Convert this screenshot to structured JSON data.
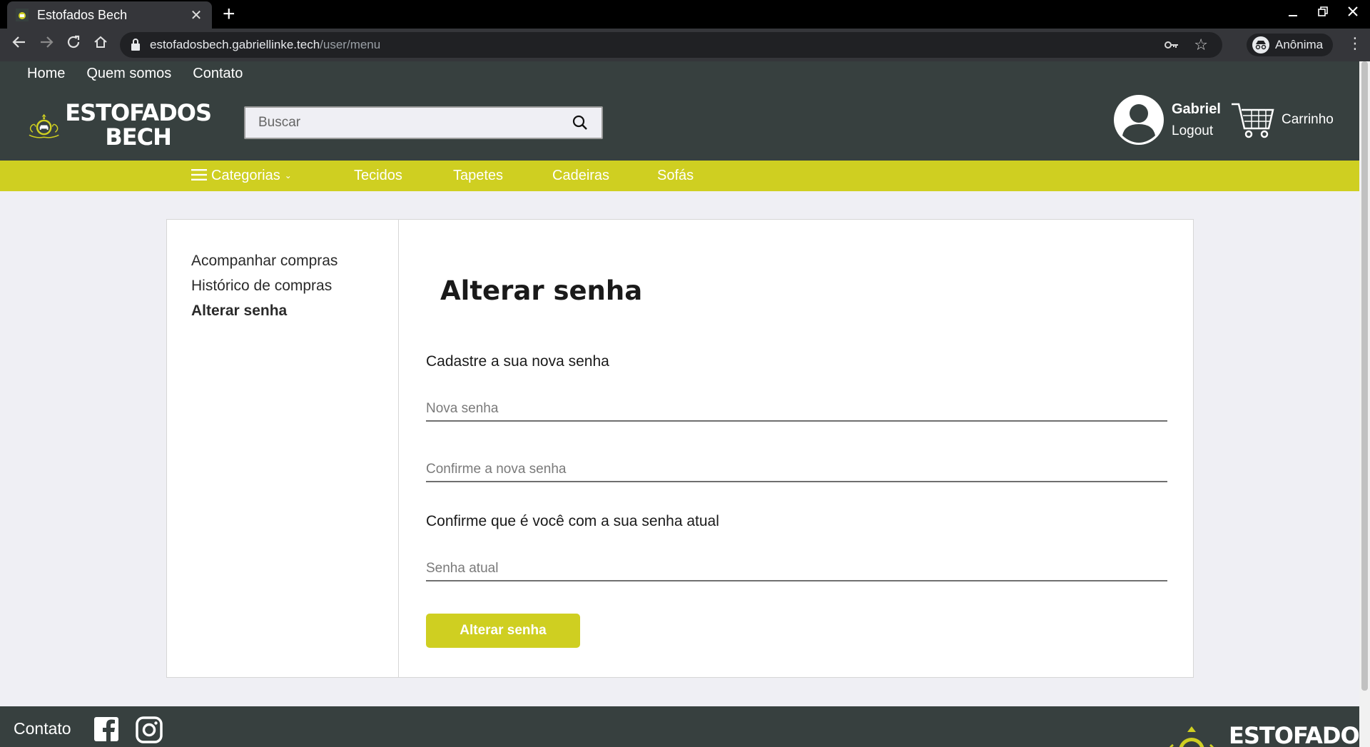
{
  "browser": {
    "tab_title": "Estofados Bech",
    "tab_close": "✕",
    "new_tab": "+",
    "url_domain": "estofadosbech.gabriellinke.tech",
    "url_path": "/user/menu",
    "incognito_label": "Anônima"
  },
  "header": {
    "top_links": [
      "Home",
      "Quem somos",
      "Contato"
    ],
    "logo_line1": "ESTOFADOS",
    "logo_line2": "BECH",
    "search_placeholder": "Buscar",
    "user_name": "Gabriel",
    "logout_label": "Logout",
    "cart_label": "Carrinho"
  },
  "category_nav": {
    "categories_label": "Categorias",
    "items": [
      "Tecidos",
      "Tapetes",
      "Cadeiras",
      "Sofás"
    ]
  },
  "side_menu": {
    "items": [
      "Acompanhar compras",
      "Histórico de compras",
      "Alterar senha"
    ],
    "active": "Alterar senha"
  },
  "form": {
    "title": "Alterar senha",
    "new_section_label": "Cadastre a sua nova senha",
    "new_password_placeholder": "Nova senha",
    "confirm_password_placeholder": "Confirme a nova senha",
    "current_section_label": "Confirme que é você com a sua senha atual",
    "current_password_placeholder": "Senha atual",
    "submit_label": "Alterar senha"
  },
  "footer": {
    "contact_label": "Contato",
    "logo_line1": "ESTOFADOS"
  },
  "colors": {
    "brand_yellow": "#cfcf21",
    "header_dark": "#37403f",
    "page_bg": "#efeff4"
  }
}
